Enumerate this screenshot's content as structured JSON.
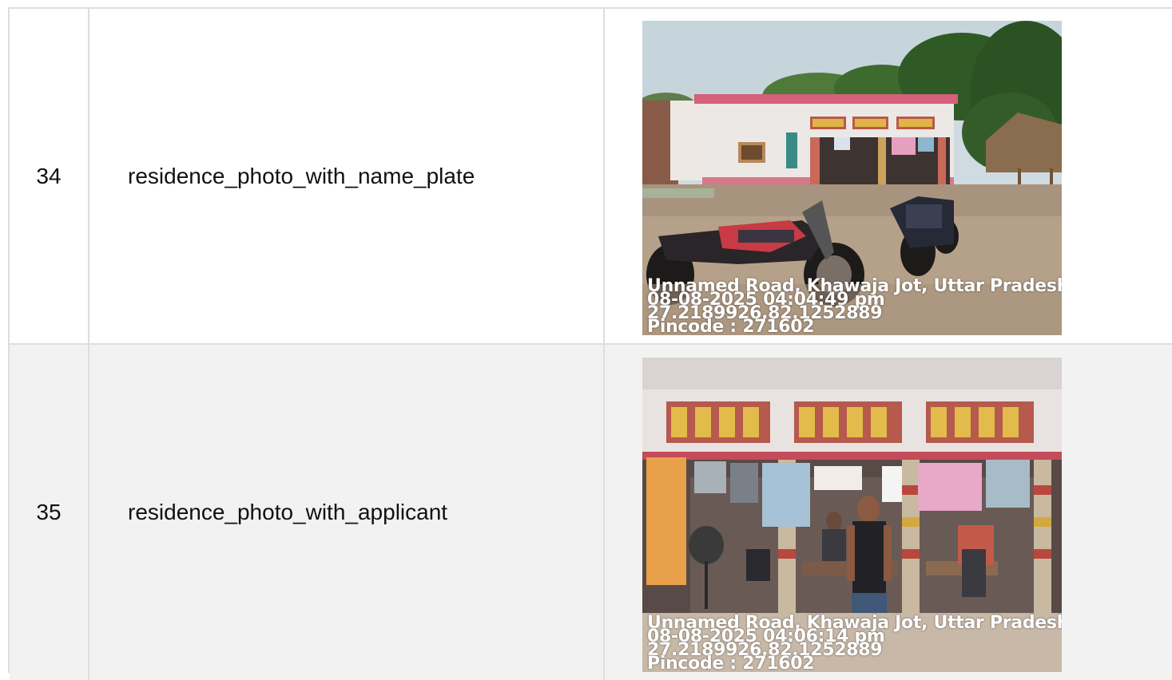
{
  "rows": [
    {
      "number": "34",
      "label": "residence_photo_with_name_plate",
      "photo": {
        "subject": "residence-exterior-with-motorcycles",
        "stamp": {
          "address": "Unnamed Road, Khawaja Jot, Uttar Pradesh",
          "datetime": "08-08-2025 04:04:49 pm",
          "coordinates": "27.2189926,82.1252889",
          "pincode": "Pincode : 271602"
        }
      }
    },
    {
      "number": "35",
      "label": "residence_photo_with_applicant",
      "photo": {
        "subject": "residence-veranda-with-applicant",
        "stamp": {
          "address": "Unnamed Road, Khawaja Jot, Uttar Pradesh",
          "datetime": "08-08-2025 04:06:14 pm",
          "coordinates": "27.2189926,82.1252889",
          "pincode": "Pincode : 271602"
        }
      }
    }
  ]
}
